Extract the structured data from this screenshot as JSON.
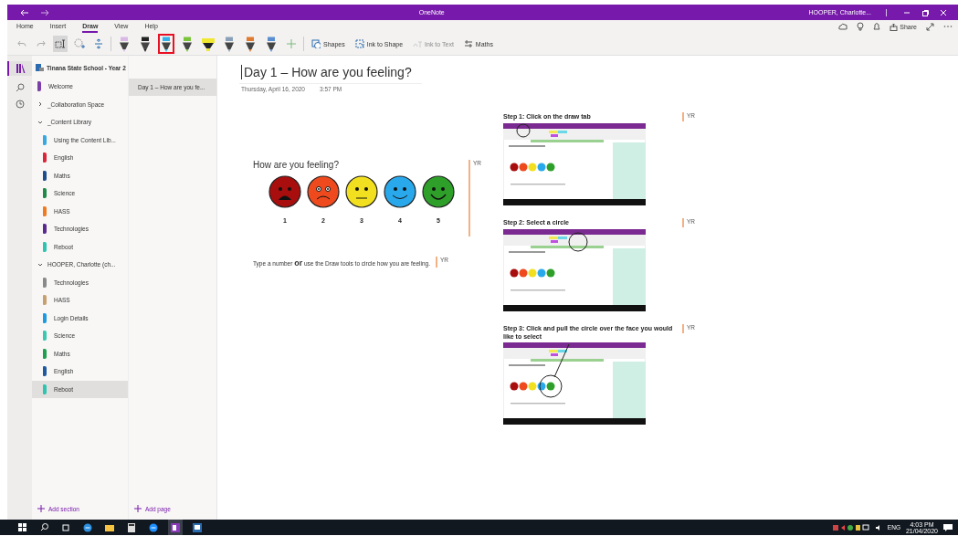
{
  "window": {
    "title": "OneNote",
    "user": "HOOPER, Charlotte..."
  },
  "menu_tabs": [
    {
      "label": "Home",
      "selected": false
    },
    {
      "label": "Insert",
      "selected": false
    },
    {
      "label": "Draw",
      "selected": true
    },
    {
      "label": "View",
      "selected": false
    },
    {
      "label": "Help",
      "selected": false
    }
  ],
  "toolbar": {
    "pens": [
      {
        "kind": "pen",
        "color": "#d9b8e6",
        "selected": false
      },
      {
        "kind": "pen",
        "color": "#222222",
        "selected": false
      },
      {
        "kind": "pen",
        "color": "#35b0e8",
        "selected": true
      },
      {
        "kind": "pen",
        "color": "#7ac43a",
        "selected": false
      },
      {
        "kind": "highlighter",
        "color": "#f0e830",
        "selected": false
      },
      {
        "kind": "pen",
        "color": "#8aa0b8",
        "selected": false
      },
      {
        "kind": "pen",
        "color": "#e07a30",
        "selected": false
      },
      {
        "kind": "pen",
        "color": "#5a8ed0",
        "selected": false
      }
    ],
    "buttons": [
      {
        "kind": "shapes",
        "label": "Shapes",
        "disabled": false
      },
      {
        "kind": "ink-shape",
        "label": "Ink to Shape",
        "disabled": false
      },
      {
        "kind": "ink-text",
        "label": "Ink to Text",
        "disabled": true
      },
      {
        "kind": "maths",
        "label": "Maths",
        "disabled": false
      }
    ],
    "share": "Share"
  },
  "notebook": {
    "name": "Tinana State School - Year 2",
    "sections": [
      {
        "kind": "section",
        "name": "Welcome",
        "color": "#7b3fa8",
        "selected": false
      },
      {
        "kind": "group",
        "name": "_Collaboration Space",
        "expanded": false
      },
      {
        "kind": "group",
        "name": "_Content Library",
        "expanded": true,
        "children": [
          {
            "kind": "section",
            "name": "Using the Content Lib...",
            "color": "#3aa8e0",
            "selected": false
          },
          {
            "kind": "section",
            "name": "English",
            "color": "#d9263a",
            "selected": false
          },
          {
            "kind": "section",
            "name": "Maths",
            "color": "#1f4e8c",
            "selected": false
          },
          {
            "kind": "section",
            "name": "Science",
            "color": "#1f8a4a",
            "selected": false
          },
          {
            "kind": "section",
            "name": "HASS",
            "color": "#f07a20",
            "selected": false
          },
          {
            "kind": "section",
            "name": "Technologies",
            "color": "#5a2a90",
            "selected": false
          },
          {
            "kind": "section",
            "name": "Reboot",
            "color": "#2ec4b0",
            "selected": false
          }
        ]
      },
      {
        "kind": "group",
        "name": "HOOPER, Charlotte (ch...",
        "expanded": true,
        "children": [
          {
            "kind": "section",
            "name": "Technologies",
            "color": "#8a8a8a",
            "selected": false
          },
          {
            "kind": "section",
            "name": "HASS",
            "color": "#c8a070",
            "selected": false
          },
          {
            "kind": "section",
            "name": "Login Details",
            "color": "#1f9ae0",
            "selected": false
          },
          {
            "kind": "section",
            "name": "Science",
            "color": "#3cc8b0",
            "selected": false
          },
          {
            "kind": "section",
            "name": "Maths",
            "color": "#1fa050",
            "selected": false
          },
          {
            "kind": "section",
            "name": "English",
            "color": "#1f5aa0",
            "selected": false
          },
          {
            "kind": "section",
            "name": "Reboot",
            "color": "#2ec4b0",
            "selected": true
          }
        ]
      }
    ]
  },
  "pages": [
    {
      "title": "Day 1 – How are you fe...",
      "selected": true
    }
  ],
  "add_section": "Add section",
  "add_page": "Add page",
  "note": {
    "title": "Day 1 – How are you feeling?",
    "date": "Thursday, April 16, 2020",
    "time": "3:57 PM",
    "question": "How are you feeling?",
    "faces": [
      {
        "kind": "distressed",
        "color": "#a80e0e",
        "number": "1"
      },
      {
        "kind": "sad",
        "color": "#ee4a1e",
        "number": "2"
      },
      {
        "kind": "neutral",
        "color": "#f2e020",
        "number": "3"
      },
      {
        "kind": "smile",
        "color": "#29a8ec",
        "number": "4"
      },
      {
        "kind": "grin",
        "color": "#2ea02a",
        "number": "5"
      }
    ],
    "faces_author": "YR",
    "instruction": "Type a number **or** use the Draw tools to circle how you are feeling.",
    "instruction_author": "YR",
    "steps": [
      {
        "title": "Step 1: Click on the draw tab",
        "author": "YR",
        "kind": "tab"
      },
      {
        "title": "Step 2: Select a circle",
        "author": "YR",
        "kind": "toolbar"
      },
      {
        "title": "Step 3: Click and pull the circle over the face you would like to select",
        "author": "YR",
        "kind": "face"
      }
    ]
  },
  "taskbar": {
    "language": "ENG",
    "time": "4:03 PM",
    "date": "21/04/2020"
  }
}
